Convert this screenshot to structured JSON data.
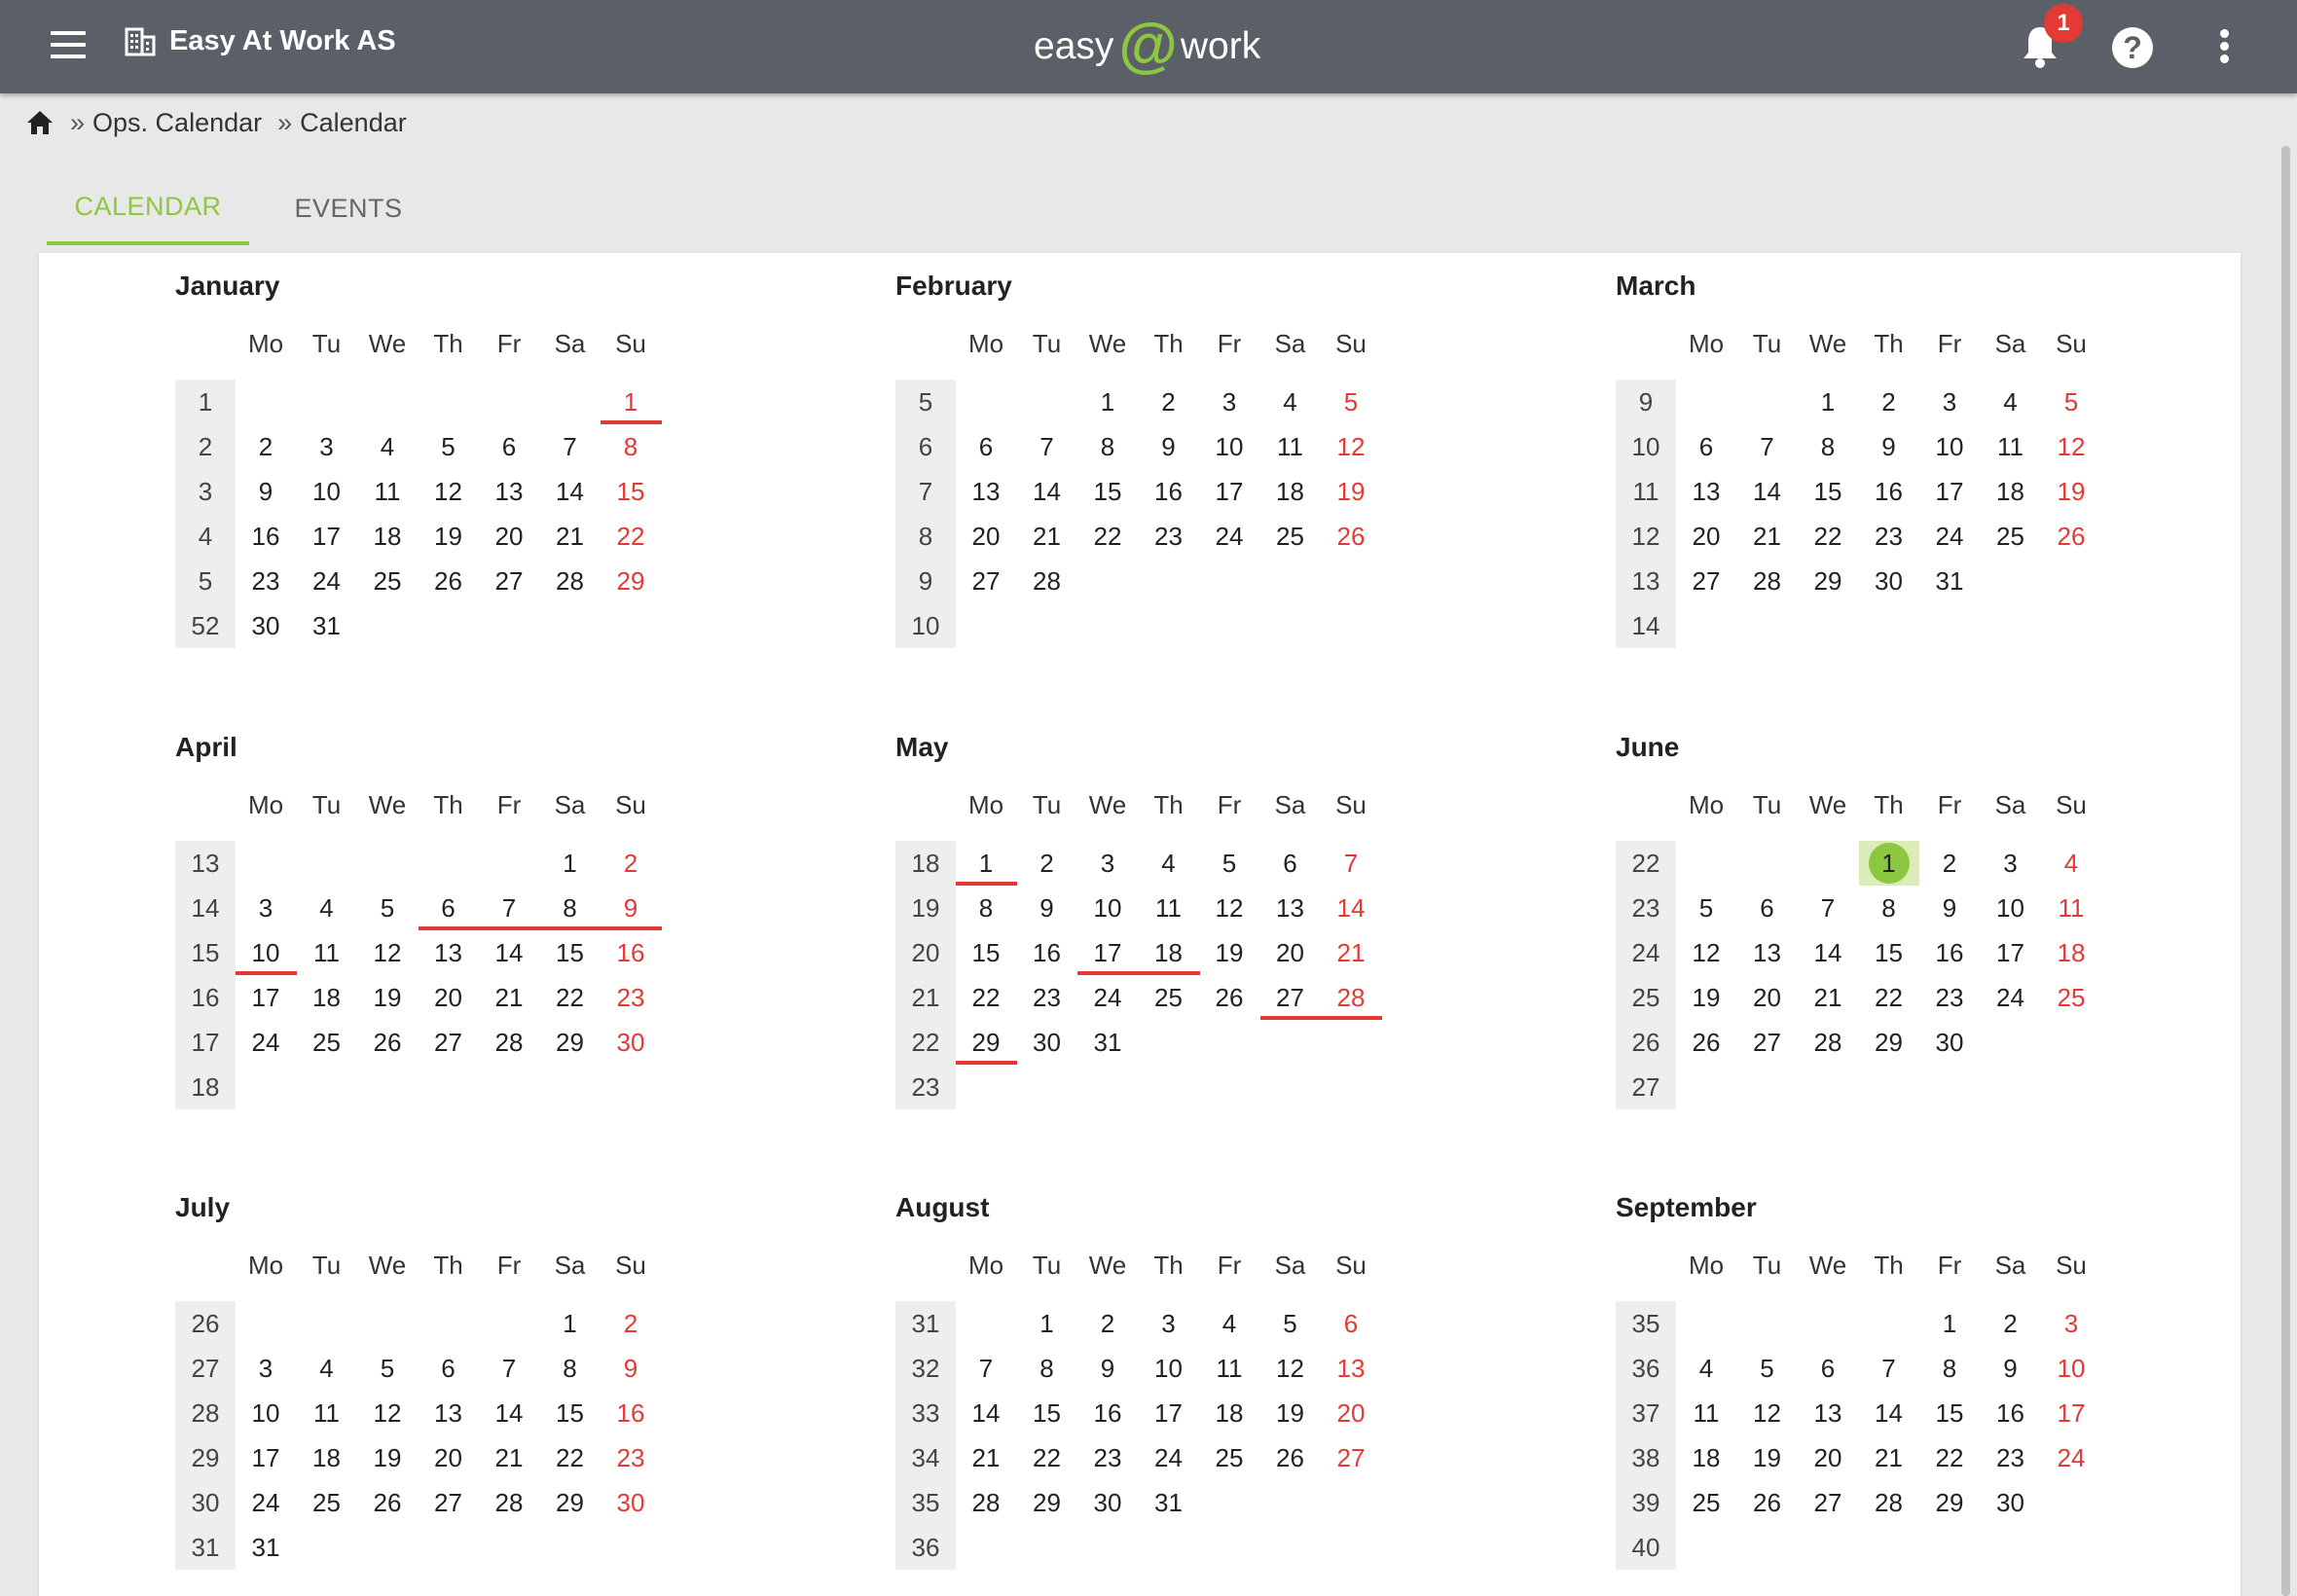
{
  "header": {
    "organization": "Easy At Work AS",
    "logo_left": "easy",
    "logo_at": "@",
    "logo_right": "work",
    "notification_count": "1",
    "help_label": "?"
  },
  "breadcrumb": {
    "home_icon": "home-icon",
    "separator": "»",
    "items": [
      "Ops. Calendar",
      "Calendar"
    ]
  },
  "tabs": [
    {
      "label": "CALENDAR",
      "active": true
    },
    {
      "label": "EVENTS",
      "active": false
    }
  ],
  "colors": {
    "accent": "#8dc63f",
    "sunday": "#e53935",
    "topbar": "#5b6068",
    "holiday_underline": "#e53935"
  },
  "weekday_labels": [
    "Mo",
    "Tu",
    "We",
    "Th",
    "Fr",
    "Sa",
    "Su"
  ],
  "today": {
    "month": "June",
    "day": 1
  },
  "months": [
    {
      "name": "January",
      "offset": 6,
      "days": 31,
      "weeks": [
        "1",
        "2",
        "3",
        "4",
        "5",
        "52"
      ],
      "holidays": [
        1
      ]
    },
    {
      "name": "February",
      "offset": 2,
      "days": 28,
      "weeks": [
        "5",
        "6",
        "7",
        "8",
        "9",
        "10"
      ],
      "holidays": []
    },
    {
      "name": "March",
      "offset": 2,
      "days": 31,
      "weeks": [
        "9",
        "10",
        "11",
        "12",
        "13",
        "14"
      ],
      "holidays": []
    },
    {
      "name": "April",
      "offset": 5,
      "days": 30,
      "weeks": [
        "13",
        "14",
        "15",
        "16",
        "17",
        "18"
      ],
      "holidays": [
        6,
        7,
        8,
        9,
        10
      ]
    },
    {
      "name": "May",
      "offset": 0,
      "days": 31,
      "weeks": [
        "18",
        "19",
        "20",
        "21",
        "22",
        "23"
      ],
      "holidays": [
        1,
        17,
        18,
        27,
        28,
        29
      ]
    },
    {
      "name": "June",
      "offset": 3,
      "days": 30,
      "weeks": [
        "22",
        "23",
        "24",
        "25",
        "26",
        "27"
      ],
      "holidays": []
    },
    {
      "name": "July",
      "offset": 5,
      "days": 31,
      "weeks": [
        "26",
        "27",
        "28",
        "29",
        "30",
        "31"
      ],
      "holidays": []
    },
    {
      "name": "August",
      "offset": 1,
      "days": 31,
      "weeks": [
        "31",
        "32",
        "33",
        "34",
        "35",
        "36"
      ],
      "holidays": []
    },
    {
      "name": "September",
      "offset": 4,
      "days": 30,
      "weeks": [
        "35",
        "36",
        "37",
        "38",
        "39",
        "40"
      ],
      "holidays": []
    }
  ]
}
